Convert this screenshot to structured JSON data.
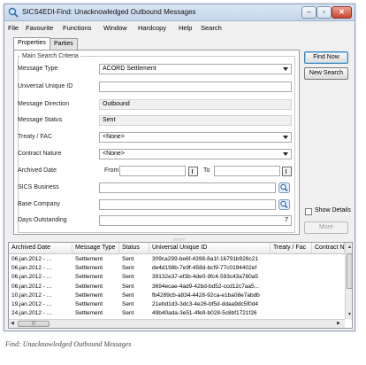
{
  "window": {
    "title": "SICS4EDI-Find: Unacknowledged Outbound Messages"
  },
  "window_controls": {
    "minimize": "–",
    "maximize": "▫",
    "close": "✕"
  },
  "menu": [
    "File",
    "Favourite",
    "Functions",
    "Window",
    "Hardcopy",
    "Help",
    "Search"
  ],
  "tabs": [
    "Properties",
    "Parties"
  ],
  "criteria": {
    "group_title": "Main Search Criteria",
    "message_type": {
      "label": "Message Type",
      "value": "ACORD Settlement"
    },
    "uuid": {
      "label": "Universal Unique ID",
      "value": ""
    },
    "message_direction": {
      "label": "Message Direction",
      "value": "Outbound"
    },
    "message_status": {
      "label": "Message Status",
      "value": "Sent"
    },
    "treaty_fac": {
      "label": "Treaty / FAC",
      "value": "<None>"
    },
    "contract_nature": {
      "label": "Contract Nature",
      "value": "<None>"
    },
    "archived_date": {
      "label": "Archived Date",
      "from_label": "From",
      "to_label": "To",
      "from": "",
      "to": ""
    },
    "sics_business": {
      "label": "SICS Business",
      "value": ""
    },
    "base_company": {
      "label": "Base Company",
      "value": ""
    },
    "days_outstanding": {
      "label": "Days Outstanding",
      "value": "7"
    }
  },
  "buttons": {
    "find_now": "Find Now",
    "new_search": "New Search",
    "more": "More"
  },
  "show_details": {
    "label": "Show Details",
    "checked": false
  },
  "splitter_grip": "○○○○○",
  "results": {
    "columns": [
      "Archived Date",
      "Message Type",
      "Status",
      "Universal Unique ID",
      "Treaty / Fac",
      "Contract Na"
    ],
    "rows": [
      [
        "06.jan.2012 - ...",
        "Settlement",
        "Sent",
        "309ca299-be6f-4398-8a1f-16791b926c21",
        "",
        ""
      ],
      [
        "06.jan.2012 - ...",
        "Settlement",
        "Sent",
        "de4d198b-7e9f-458d-bcf9-77c0194402ef",
        "",
        ""
      ],
      [
        "06.jan.2012 - ...",
        "Settlement",
        "Sent",
        "39132e37-ef3b-4de0-9fc4-593c43a780a5",
        "",
        ""
      ],
      [
        "06.jan.2012 - ...",
        "Settlement",
        "Sent",
        "3694ecae-4ad9-42bd-bd52-ccd12c7aa5...",
        "",
        ""
      ],
      [
        "10.jan.2012 - ...",
        "Settlement",
        "Sent",
        "fb4289cb-a834-4428-92ca-e1ba08e7abdb",
        "",
        ""
      ],
      [
        "19.jan.2012 - ...",
        "Settlement",
        "Sent",
        "21ebd1d3-3dc3-4e26-bf5d-ddaa9dc5f0d4",
        "",
        ""
      ],
      [
        "24.jan.2012 - ...",
        "Settlement",
        "Sent",
        "49b40ada-3e51-4fe9-b028-5c8bf1721f26",
        "",
        ""
      ]
    ],
    "hscroll_grip": "|||"
  },
  "caption": "Find: Unacknowledged Outbound Messages"
}
